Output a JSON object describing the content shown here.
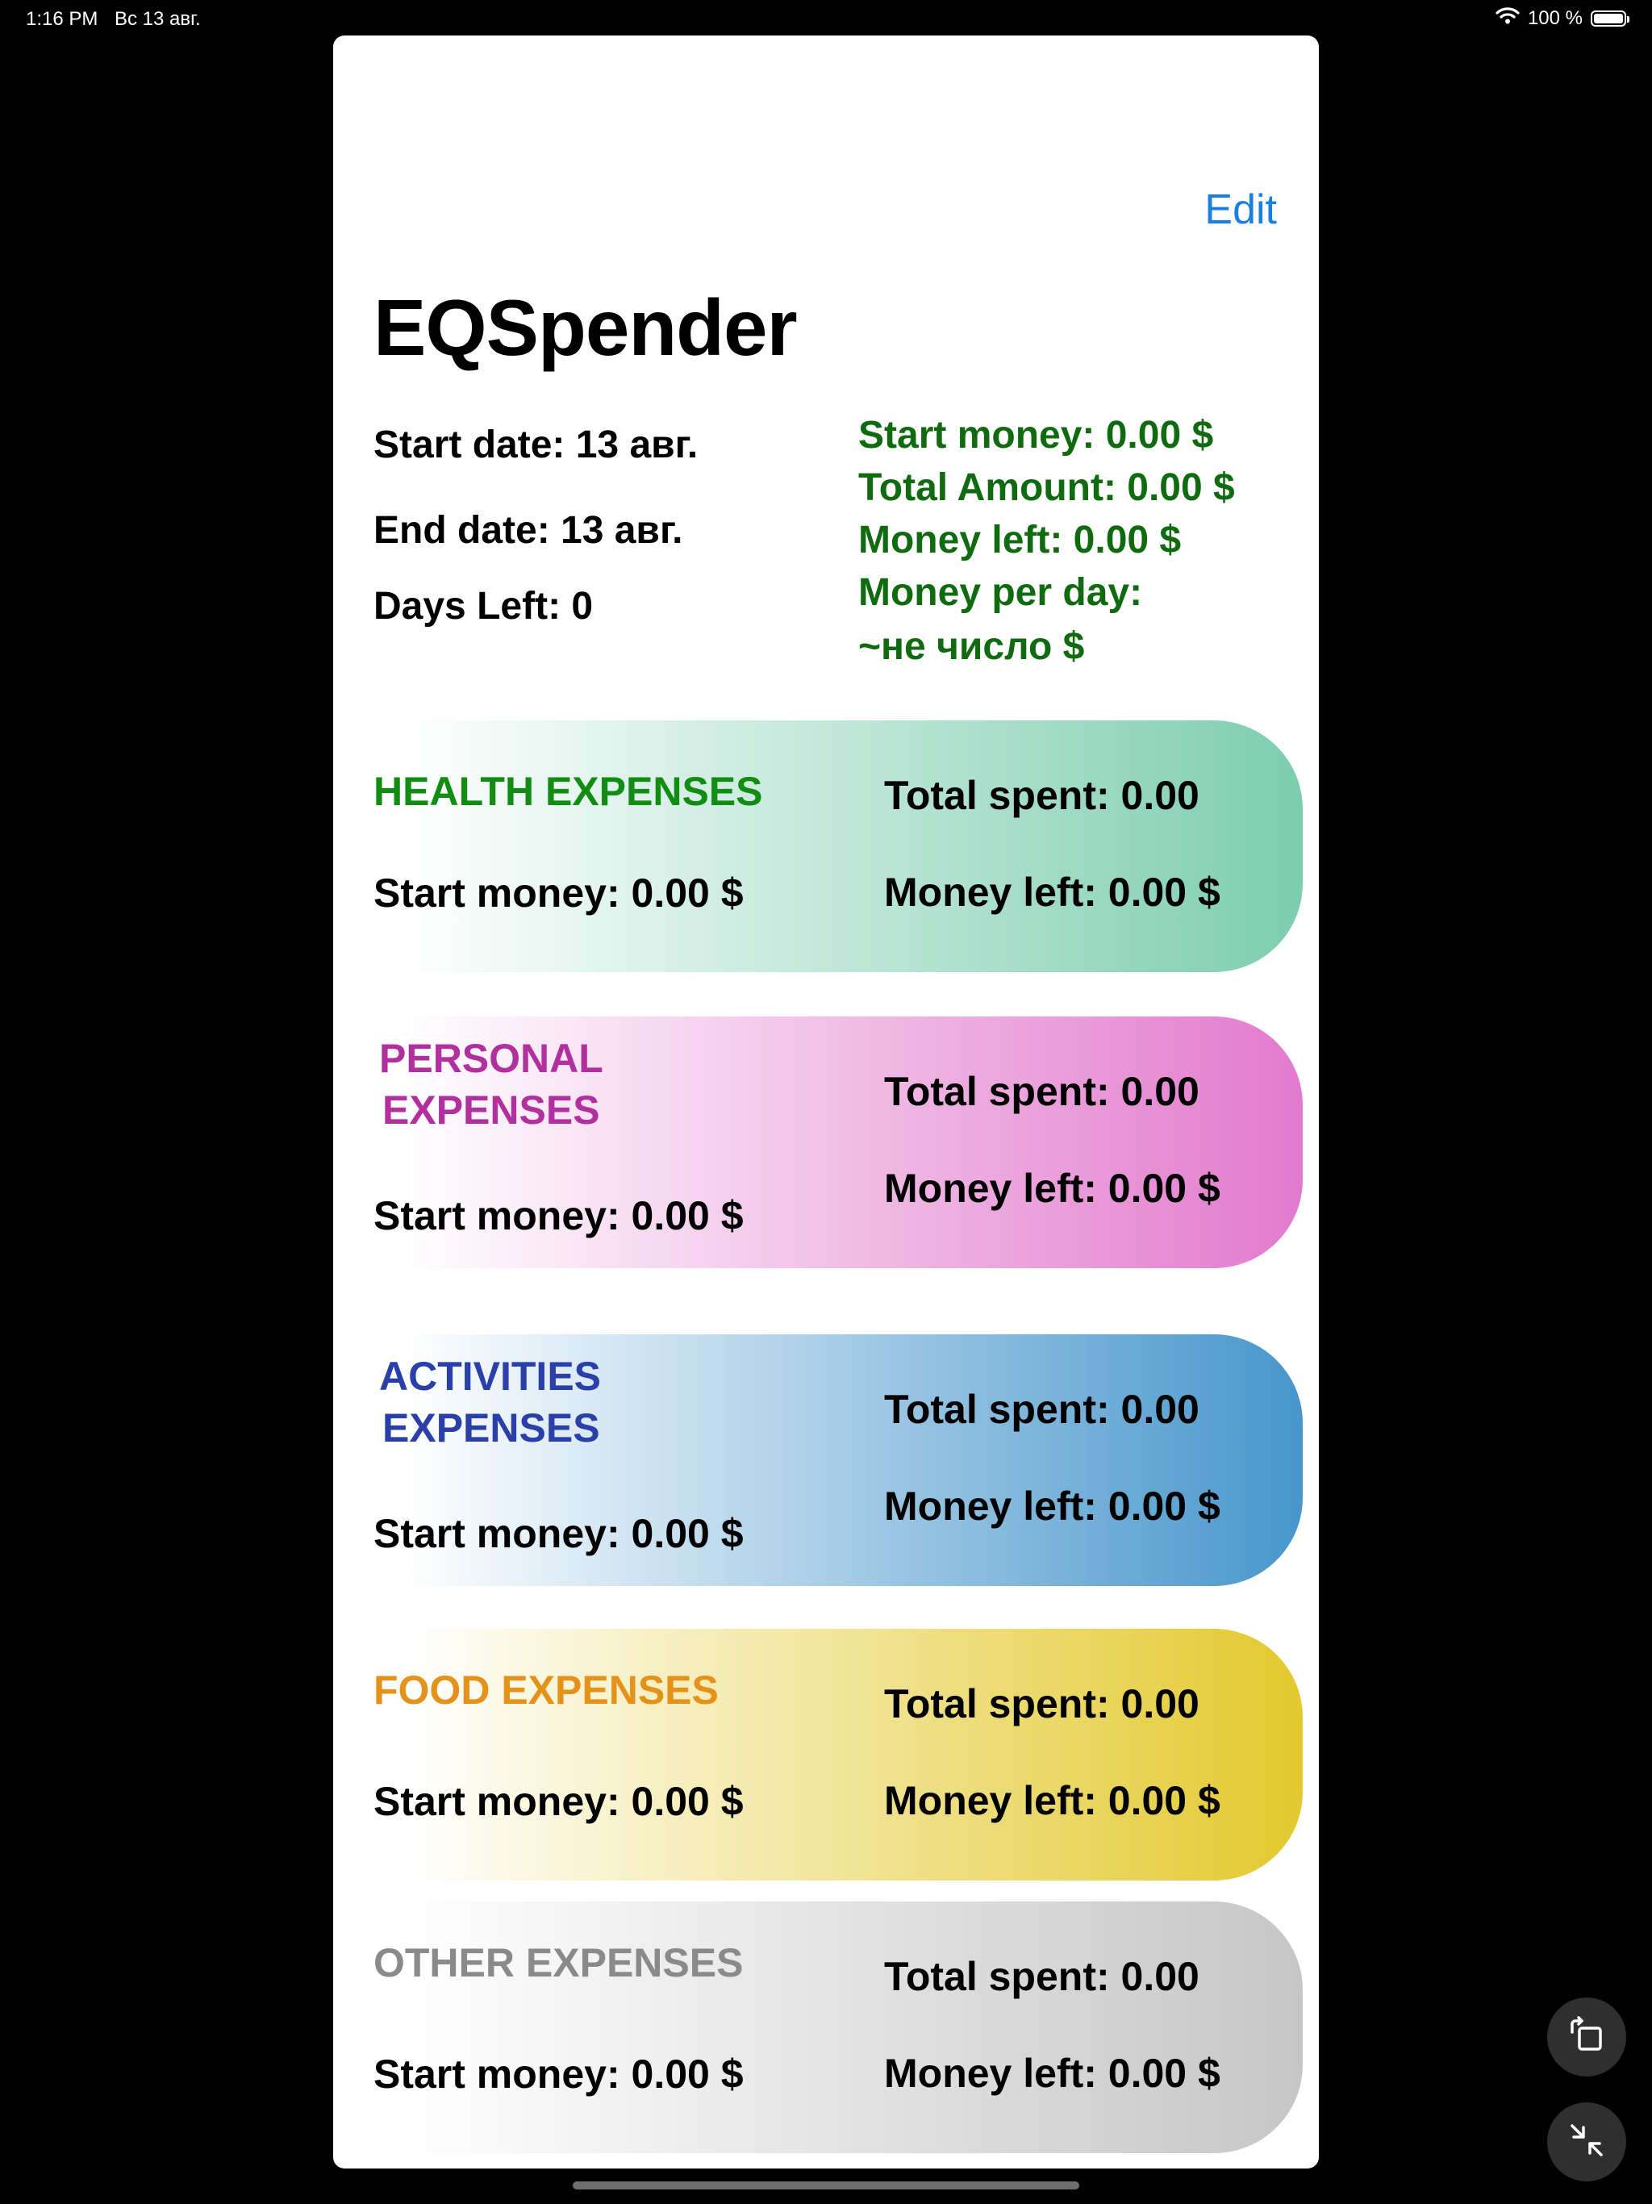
{
  "status_bar": {
    "time": "1:16 PM",
    "date": "Вс 13 авг.",
    "battery": "100 %"
  },
  "nav": {
    "edit_label": "Edit"
  },
  "header": {
    "title": "EQSpender",
    "start_date": "Start date: 13 авг.",
    "end_date": "End date: 13 авг.",
    "days_left": "Days Left: 0",
    "start_money": "Start money: 0.00 $",
    "total_amount": "Total Amount: 0.00 $",
    "money_left": "Money left: 0.00 $",
    "money_per_day_label": "Money per day:",
    "money_per_day_value": "~не число $"
  },
  "categories": [
    {
      "line1": "HEALTH EXPENSES",
      "line2": "",
      "start": "Start money: 0.00 $",
      "spent": "Total spent: 0.00",
      "left": "Money left: 0.00 $",
      "color": "#128c12",
      "gradient_end": "#7dcdb0"
    },
    {
      "line1": "PERSONAL",
      "line2": "EXPENSES",
      "start": "Start money: 0.00 $",
      "spent": "Total spent: 0.00",
      "left": "Money left: 0.00 $",
      "color": "#b2309e",
      "gradient_end": "#e27acd"
    },
    {
      "line1": "ACTIVITIES",
      "line2": "EXPENSES",
      "start": "Start money: 0.00 $",
      "spent": "Total spent: 0.00",
      "left": "Money left: 0.00 $",
      "color": "#2b3fa8",
      "gradient_end": "#4796cc"
    },
    {
      "line1": "FOOD EXPENSES",
      "line2": "",
      "start": "Start money: 0.00 $",
      "spent": "Total spent: 0.00",
      "left": "Money left: 0.00 $",
      "color": "#e5921a",
      "gradient_end": "#e3c92e"
    },
    {
      "line1": "OTHER EXPENSES",
      "line2": "",
      "start": "Start money: 0.00 $",
      "spent": "Total spent: 0.00",
      "left": "Money left: 0.00 $",
      "color": "#8a8a8a",
      "gradient_end": "#c6c6c6"
    }
  ],
  "controls": {
    "rotate_icon": "rotate-icon",
    "collapse_icon": "collapse-icon"
  }
}
